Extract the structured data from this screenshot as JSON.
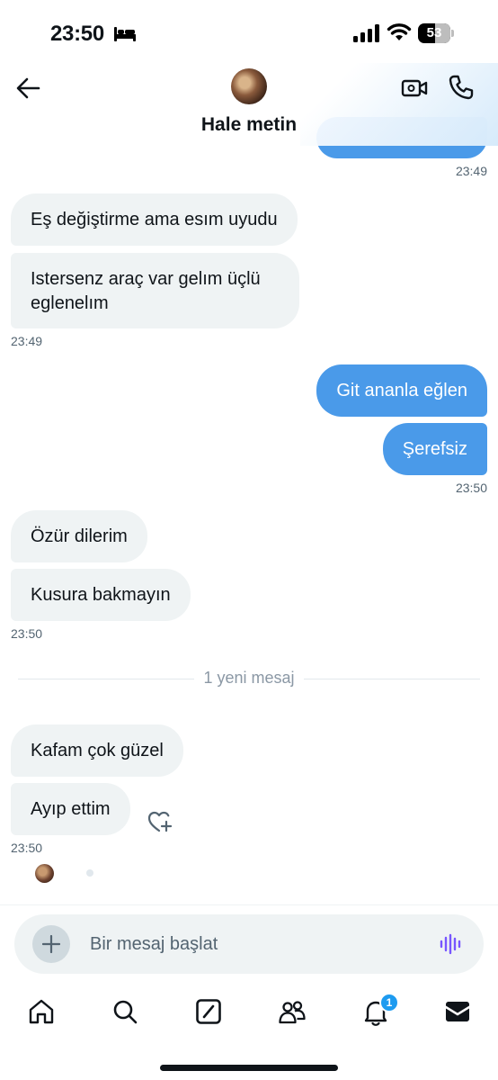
{
  "status_bar": {
    "time": "23:50",
    "battery": "53",
    "battery_level": 0.53
  },
  "header": {
    "contact_name": "Hale metin"
  },
  "messages": {
    "top_timestamp": "23:49",
    "m1": "Eş değiştirme ama esım uyudu",
    "m2_line1": "Istersenz araç var gelım üçlü",
    "m2_line2": "eglenelım",
    "ts_1": "23:49",
    "m3": "Git ananla eğlen",
    "m4": "Şerefsiz",
    "ts_2": "23:50",
    "m5": "Özür dilerim",
    "m6": "Kusura bakmayın",
    "ts_3": "23:50",
    "divider": "1 yeni mesaj",
    "m7": "Kafam çok güzel",
    "m8": "Ayıp ettim",
    "ts_4": "23:50"
  },
  "composer": {
    "placeholder": "Bir mesaj başlat"
  },
  "tabbar": {
    "notifications_badge": "1"
  },
  "colors": {
    "outgoing_bubble": "#4a9ae9",
    "incoming_bubble": "#eff3f4",
    "accent": "#1d9bf0",
    "voice_icon": "#7856ff"
  },
  "icons": {
    "back": "arrow-left-icon",
    "video": "video-camera-icon",
    "call": "phone-icon",
    "add": "plus-icon",
    "voice": "voice-wave-icon",
    "react": "heart-plus-icon",
    "tabs": [
      "home-icon",
      "search-icon",
      "grok-icon",
      "communities-icon",
      "bell-icon",
      "mail-icon"
    ]
  }
}
